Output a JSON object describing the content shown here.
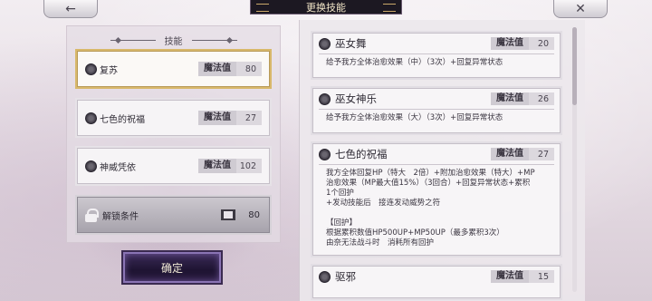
{
  "header": {
    "back_icon": "←",
    "title": "更换技能",
    "close_icon": "✕"
  },
  "left_panel": {
    "header": "技能",
    "skills": [
      {
        "name": "复苏",
        "mp_label": "魔法值",
        "mp": "80",
        "selected": true
      },
      {
        "name": "七色的祝福",
        "mp_label": "魔法值",
        "mp": "27",
        "selected": false
      },
      {
        "name": "神威凭依",
        "mp_label": "魔法值",
        "mp": "102",
        "selected": false
      }
    ],
    "unlock": {
      "label": "解锁条件",
      "count": "80"
    },
    "confirm": "确定"
  },
  "skill_list": [
    {
      "name": "巫女舞",
      "mp_label": "魔法值",
      "mp": "20",
      "desc": "给予我方全体治愈效果（中）（3次）+回复异常状态"
    },
    {
      "name": "巫女神乐",
      "mp_label": "魔法值",
      "mp": "26",
      "desc": "给予我方全体治愈效果（大）（3次）+回复异常状态"
    },
    {
      "name": "七色的祝福",
      "mp_label": "魔法值",
      "mp": "27",
      "desc": "我方全体回复HP（特大　2倍）+附加治愈效果（特大）+MP\n治愈效果（MP最大值15%）（3回合）+回复异常状态+累积\n1个回护\n+发动技能后　接连发动威势之符\n\n【回护】\n根据累积数值HP500UP+MP50UP（最多累积3次）\n由奈无法战斗时　消耗所有回护"
    },
    {
      "name": "驱邪",
      "mp_label": "魔法值",
      "mp": "15",
      "desc": ""
    }
  ],
  "colors": {
    "accent": "#d8b86a",
    "confirm_bg": "#1e1432",
    "title_bg": "#1c1822"
  }
}
